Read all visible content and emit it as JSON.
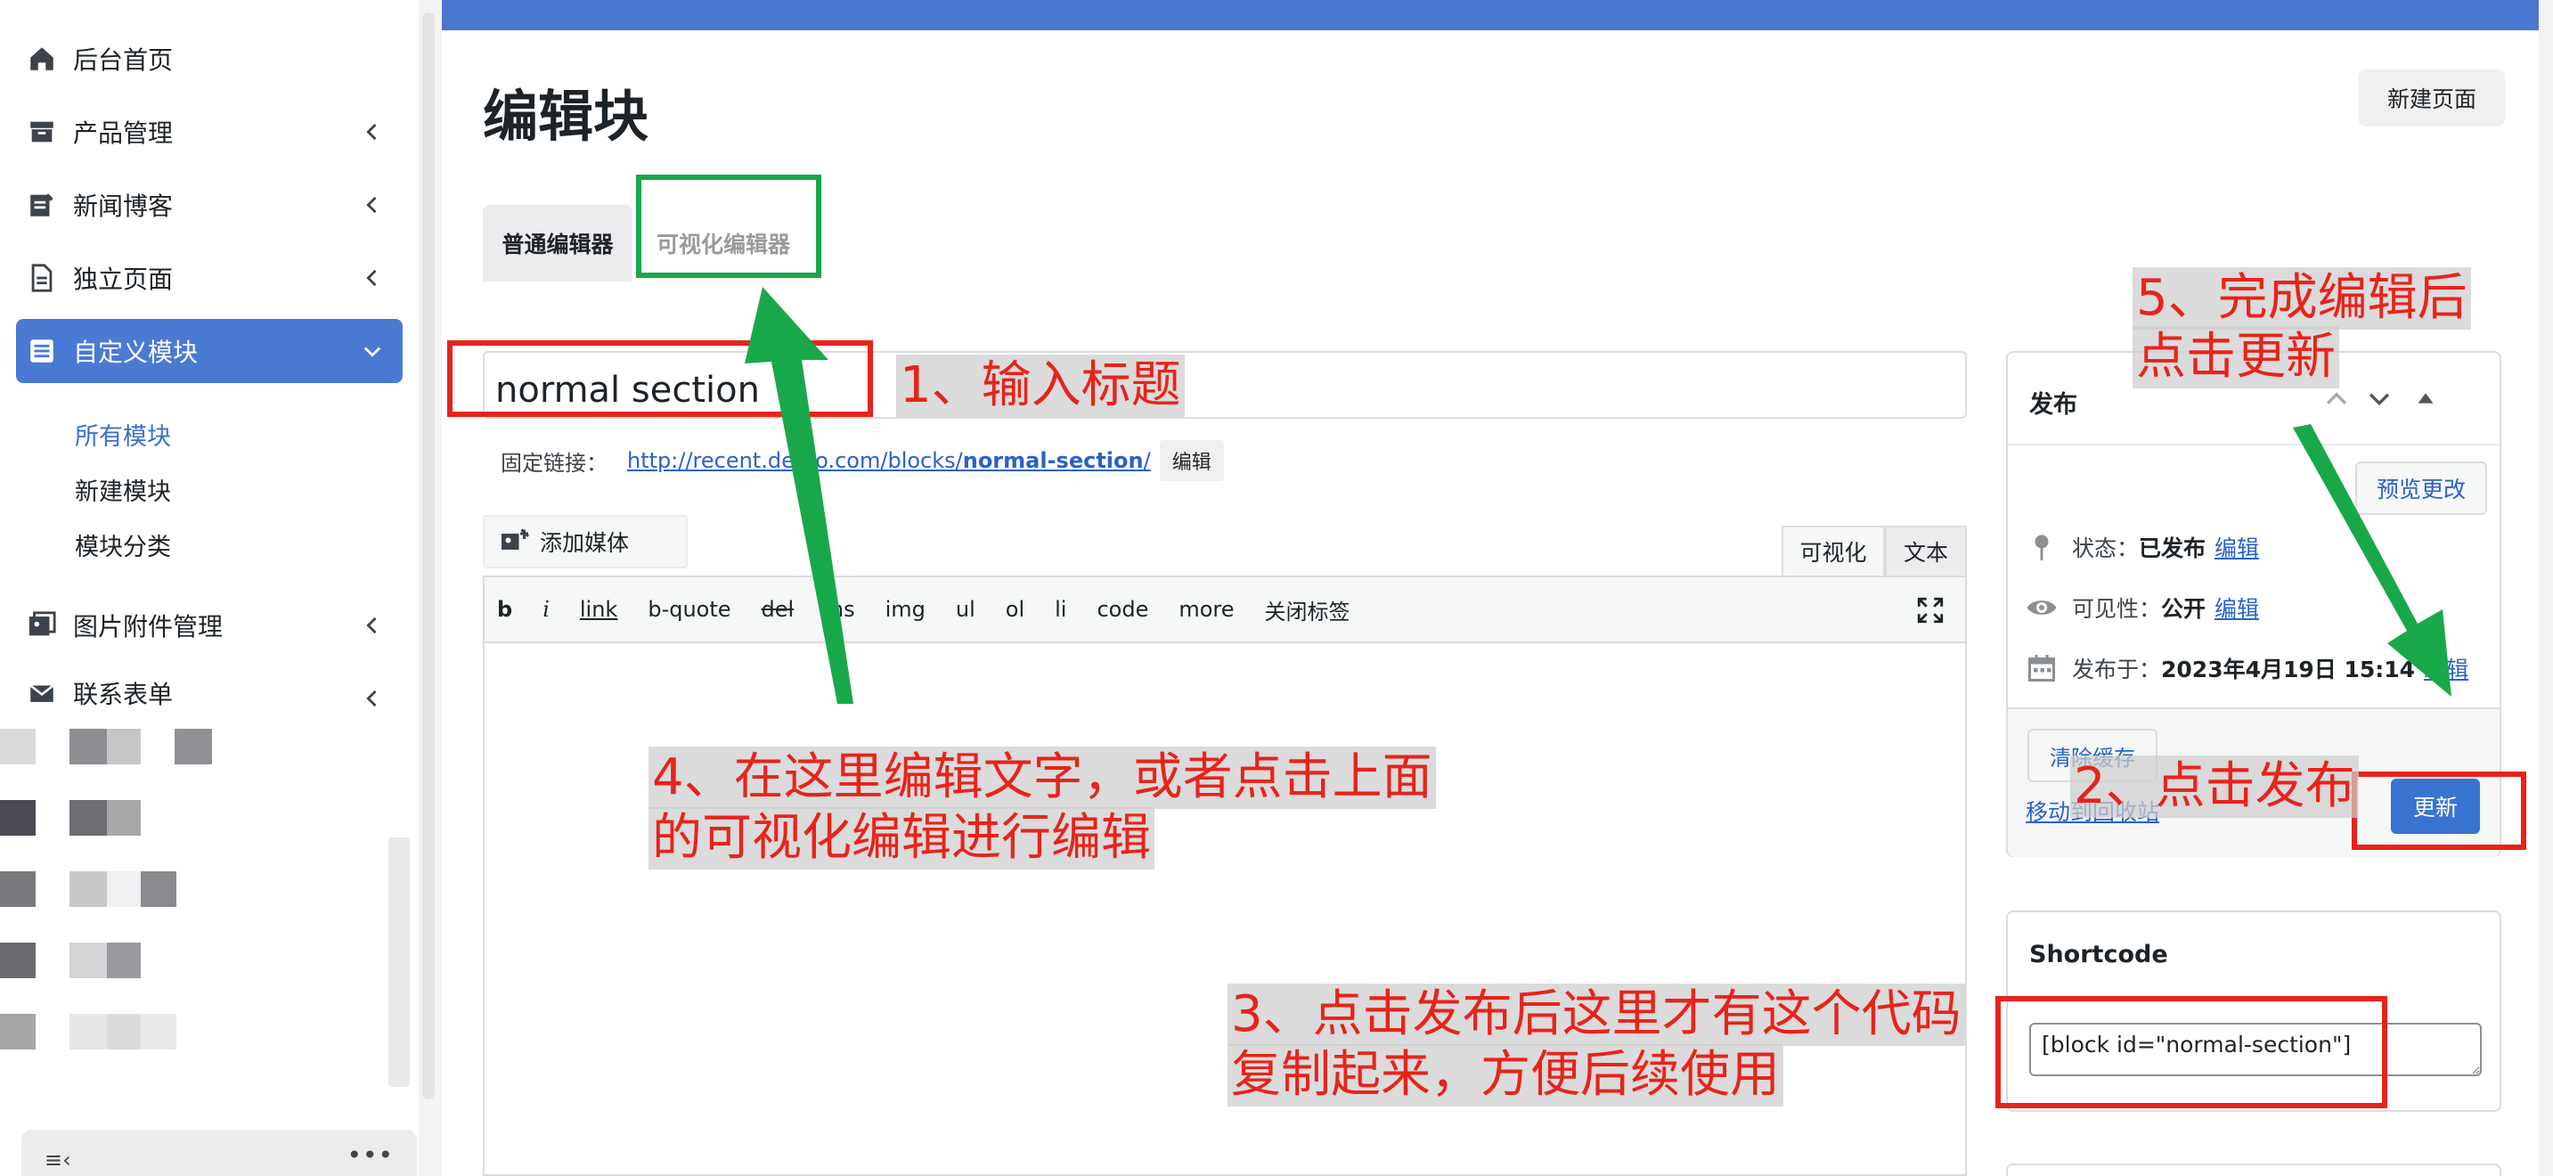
{
  "sidebar": {
    "items": [
      {
        "label": "后台首页"
      },
      {
        "label": "产品管理"
      },
      {
        "label": "新闻博客"
      },
      {
        "label": "独立页面"
      },
      {
        "label": "自定义模块"
      },
      {
        "label": "图片附件管理"
      },
      {
        "label": "联系表单"
      }
    ],
    "sub_items": [
      {
        "label": "所有模块"
      },
      {
        "label": "新建模块"
      },
      {
        "label": "模块分类"
      }
    ],
    "active_color": "#4a7ad2"
  },
  "main": {
    "page_title": "编辑块",
    "new_page_label": "新建页面",
    "tabs": [
      {
        "label": "普通编辑器"
      },
      {
        "label": "可视化编辑器"
      }
    ],
    "title_value": "normal section",
    "permalink": {
      "label": "固定链接：",
      "url_base": "http://recent.demo.com/blocks/",
      "url_slug": "normal-section",
      "url_end": "/",
      "edit_label": "编辑"
    },
    "add_media_label": "添加媒体",
    "mode_tabs": {
      "visual": "可视化",
      "text": "文本"
    },
    "quicktags": [
      "b",
      "i",
      "link",
      "b-quote",
      "del",
      "ins",
      "img",
      "ul",
      "ol",
      "li",
      "code",
      "more",
      "关闭标签"
    ]
  },
  "publish": {
    "title": "发布",
    "preview_label": "预览更改",
    "status_label": "状态：",
    "status_value": "已发布",
    "visibility_label": "可见性：",
    "visibility_value": "公开",
    "published_label": "发布于：",
    "published_value": "2023年4月19日 15:14",
    "edit_link": "编辑",
    "clear_cache_label": "清除缓存",
    "trash_label": "移动到回收站",
    "update_label": "更新"
  },
  "shortcode": {
    "title": "Shortcode",
    "value": "[block id=\"normal-section\"]"
  },
  "annotations": {
    "step1": "1、输入标题",
    "step2": "2、点击发布",
    "step3_line1": "3、点击发布后这里才有这个代码",
    "step3_line2": "复制起来，方便后续使用",
    "step4_line1": "4、在这里编辑文字，或者点击上面",
    "step4_line2": "的可视化编辑进行编辑",
    "step5_line1": "5、完成编辑后",
    "step5_line2": "点击更新",
    "red": "#e8231b",
    "green": "#18a84a"
  }
}
